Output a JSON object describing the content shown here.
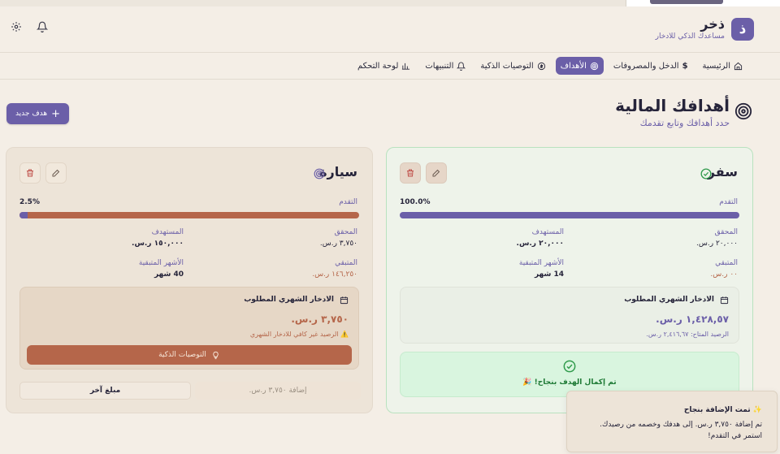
{
  "app": {
    "logo": "ذ",
    "title": "ذخر",
    "subtitle": "مساعدك الذكي للادخار",
    "settings_icon": "gear-icon",
    "bell_icon": "bell-icon"
  },
  "nav": [
    {
      "label": "الرئيسية",
      "icon": "home-icon",
      "active": false
    },
    {
      "label": "الدخل والمصروفات",
      "icon": "dollar-icon",
      "active": false
    },
    {
      "label": "الأهداف",
      "icon": "target-icon",
      "active": true
    },
    {
      "label": "التوصيات الذكية",
      "icon": "dollar-circle-icon",
      "active": false
    },
    {
      "label": "التنبيهات",
      "icon": "bell-icon",
      "active": false
    },
    {
      "label": "لوحة التحكم",
      "icon": "chart-icon",
      "active": false
    }
  ],
  "page": {
    "title": "أهدافك المالية",
    "subtitle": "حدد أهدافك وتابع تقدمك",
    "new_goal_label": "هدف جديد"
  },
  "goals": [
    {
      "name": "سفر",
      "status_icon": "check-circle-icon",
      "progress_label": "التقدم",
      "progress_text": "100.0%",
      "progress": 1.0,
      "achieved_label": "المحقق",
      "achieved_value": "٢٠,٠٠٠ ر.س.",
      "target_label": "المستهدف",
      "target_value": "٢٠,٠٠٠ ر.س.",
      "remaining_label": "المتبقي",
      "remaining_value": "٠٠ ر.س.",
      "months_label": "الأشهر المتبقية",
      "months_value": "14 شهر",
      "monthly_title": "الادخار الشهري المطلوب",
      "monthly_amount": "١,٤٢٨,٥٧ ر.س.",
      "monthly_note": "الرصيد المتاح: ٢,٤١٦,٦٧ ر.س.",
      "complete_text": "تم إكمال الهدف بنجاح! 🎉"
    },
    {
      "name": "سيارة",
      "status_icon": "target-icon",
      "progress_label": "التقدم",
      "progress_text": "2.5%",
      "progress": 0.025,
      "achieved_label": "المحقق",
      "achieved_value": "٣,٧٥٠ ر.س.",
      "target_label": "المستهدف",
      "target_value": "١٥٠,٠٠٠ ر.س.",
      "remaining_label": "المتبقي",
      "remaining_value": "١٤٦,٢٥٠ ر.س.",
      "months_label": "الأشهر المتبقية",
      "months_value": "40 شهر",
      "monthly_title": "الادخار الشهري المطلوب",
      "monthly_amount": "٣,٧٥٠ ر.س.",
      "monthly_note": "⚠️ الرصيد غير كافي للادخار الشهري",
      "smart_button": "التوصيات الذكية",
      "add_button": "إضافة ٣,٧٥٠ ر.س.",
      "other_button": "مبلغ آخر"
    }
  ],
  "toast": {
    "title": "✨ تمت الإضافة بنجاح",
    "body": "تم إضافة ٣,٧٥٠ ر.س. إلى هدفك وخصمه من رصيدك. استمر في التقدم!"
  },
  "colors": {
    "accent": "#6b5fa8",
    "warning": "#b5664a",
    "success": "#1f7a36"
  }
}
